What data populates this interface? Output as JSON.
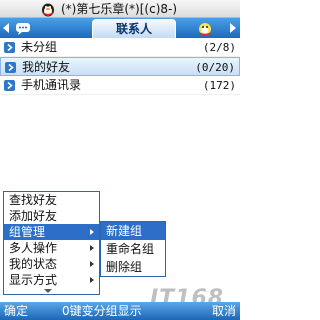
{
  "window": {
    "title": "(*)第七乐章(*)[(c)8-)",
    "logo_icon": "qq-penguin-icon"
  },
  "tabs": {
    "left_arrow_icon": "left-arrow-icon",
    "chat_icon": "chat-bubble-icon",
    "active_label": "联系人",
    "right_icon": "qq-group-icon",
    "right_arrow_icon": "right-arrow-icon"
  },
  "groups": [
    {
      "name": "未分组",
      "count": "(2/8)",
      "selected": false
    },
    {
      "name": "我的好友",
      "count": "(0/20)",
      "selected": true
    },
    {
      "name": "手机通讯录",
      "count": "(172)",
      "selected": false
    }
  ],
  "menu": {
    "items": [
      {
        "label": "查找好友",
        "has_submenu": false,
        "active": false
      },
      {
        "label": "添加好友",
        "has_submenu": false,
        "active": false
      },
      {
        "label": "组管理",
        "has_submenu": true,
        "active": true
      },
      {
        "label": "多人操作",
        "has_submenu": true,
        "active": false
      },
      {
        "label": "我的状态",
        "has_submenu": true,
        "active": false
      },
      {
        "label": "显示方式",
        "has_submenu": true,
        "active": false
      }
    ]
  },
  "submenu": {
    "items": [
      {
        "label": "新建组",
        "active": true
      },
      {
        "label": "重命名组",
        "active": false
      },
      {
        "label": "删除组",
        "active": false
      }
    ]
  },
  "softkeys": {
    "left": "确定",
    "center": "0键变分组显示",
    "right": "取消"
  },
  "watermark": "IT168",
  "colors": {
    "accent": "#1c66b6",
    "selection": "#2d6ec8"
  }
}
